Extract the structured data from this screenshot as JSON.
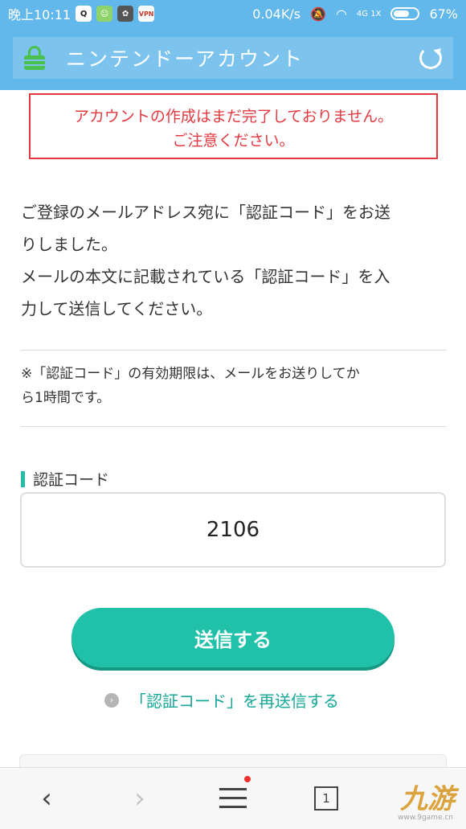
{
  "status_bar": {
    "time": "晚上10:11",
    "network_speed": "0.04K/s",
    "network_type": "4G 1X",
    "battery": "67%",
    "battery_level": 0.67,
    "app_icons": [
      "qq-icon",
      "wechat-icon",
      "game-icon",
      "vpn-icon"
    ]
  },
  "header": {
    "title": "ニンテンドーアカウント",
    "lock_color": "#4cc04e",
    "background": "#62b8ea"
  },
  "warning": {
    "line1": "アカウントの作成はまだ完了しておりません。",
    "line2": "ご注意ください。",
    "color": "#e23a40"
  },
  "intro": {
    "line1": "ご登録のメールアドレス宛に「認証コード」をお送",
    "line2": "りしました。",
    "line3": "メールの本文に記載されている「認証コード」を入",
    "line4": "力して送信してください。"
  },
  "note": {
    "line1": "※「認証コード」の有効期限は、メールをお送りしてか",
    "line2": "ら1時間です。"
  },
  "code_field": {
    "label": "認証コード",
    "value": "2106"
  },
  "submit_button": {
    "label": "送信する",
    "color": "#20c1a8"
  },
  "resend_link": {
    "label": "「認証コード」を再送信する"
  },
  "bottom_nav": {
    "back": "‹",
    "forward": "›",
    "tab_count": "1"
  },
  "watermark": {
    "text": "九游",
    "sub": "www.9game.cn"
  }
}
